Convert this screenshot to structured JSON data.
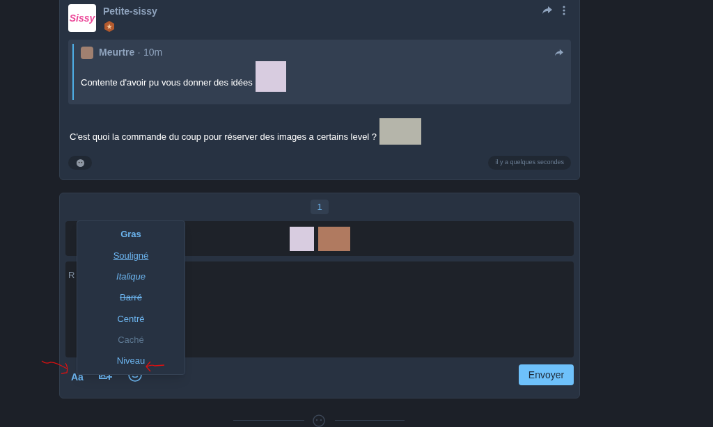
{
  "post": {
    "author": "Petite-sissy",
    "logo_text": "Sissy",
    "quote": {
      "author": "Meurtre",
      "time": "· 10m",
      "text": "Contente d'avoir pu vous donner des idées"
    },
    "text": "C'est quoi la commande du coup pour réserver des images a certains level ?",
    "timestamp": "il y a quelques secondes"
  },
  "composer": {
    "format_button": "Aa",
    "page": "1",
    "placeholder": "R",
    "send": "Envoyer",
    "format_menu": [
      {
        "label": "Gras",
        "kind": "bold"
      },
      {
        "label": "Souligné",
        "kind": "underline"
      },
      {
        "label": "Italique",
        "kind": "italic"
      },
      {
        "label": "Barré",
        "kind": "strike"
      },
      {
        "label": "Centré",
        "kind": "plain"
      },
      {
        "label": "Caché",
        "kind": "muted"
      },
      {
        "label": "Niveau",
        "kind": "plain"
      }
    ]
  }
}
